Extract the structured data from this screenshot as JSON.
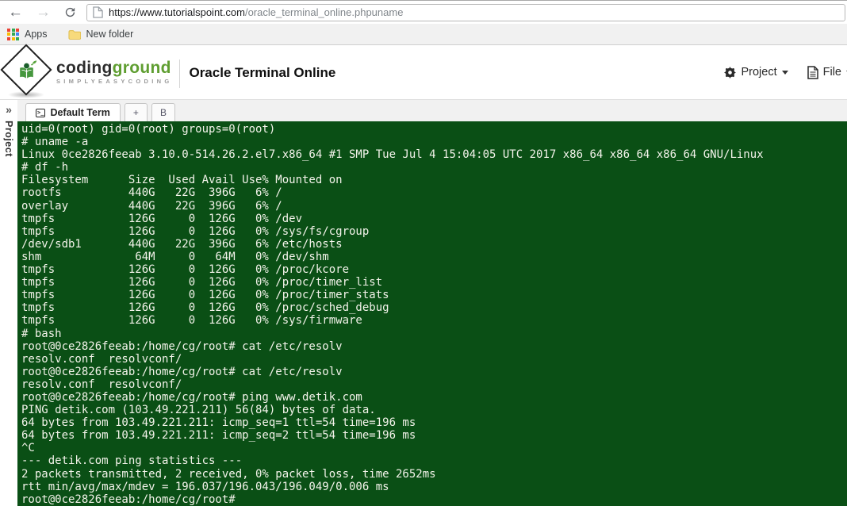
{
  "browser": {
    "back_glyph": "←",
    "forward_glyph": "→",
    "url_host": "https://www.tutorialspoint.com",
    "url_path": "/oracle_terminal_online.phpuname",
    "bookmarks": [
      {
        "label": "Apps"
      },
      {
        "label": "New folder"
      }
    ]
  },
  "header": {
    "brand_coding": "coding",
    "brand_ground": "ground",
    "brand_tagline": "SIMPLYEASYCODING",
    "page_title": "Oracle Terminal Online",
    "project_menu": "Project",
    "file_menu": "File"
  },
  "sidebar": {
    "collapse_icon": "»",
    "panel_label": "Project"
  },
  "tabs": {
    "icon_glyph": ">_",
    "active_label": "Default Term",
    "add_label": "+",
    "b_label": "B"
  },
  "terminal": {
    "lines": [
      "uid=0(root) gid=0(root) groups=0(root)",
      "# uname -a",
      "Linux 0ce2826feeab 3.10.0-514.26.2.el7.x86_64 #1 SMP Tue Jul 4 15:04:05 UTC 2017 x86_64 x86_64 x86_64 GNU/Linux",
      "# df -h",
      "Filesystem      Size  Used Avail Use% Mounted on",
      "rootfs          440G   22G  396G   6% /",
      "overlay         440G   22G  396G   6% /",
      "tmpfs           126G     0  126G   0% /dev",
      "tmpfs           126G     0  126G   0% /sys/fs/cgroup",
      "/dev/sdb1       440G   22G  396G   6% /etc/hosts",
      "shm              64M     0   64M   0% /dev/shm",
      "tmpfs           126G     0  126G   0% /proc/kcore",
      "tmpfs           126G     0  126G   0% /proc/timer_list",
      "tmpfs           126G     0  126G   0% /proc/timer_stats",
      "tmpfs           126G     0  126G   0% /proc/sched_debug",
      "tmpfs           126G     0  126G   0% /sys/firmware",
      "# bash",
      "root@0ce2826feeab:/home/cg/root# cat /etc/resolv",
      "resolv.conf  resolvconf/",
      "root@0ce2826feeab:/home/cg/root# cat /etc/resolv",
      "resolv.conf  resolvconf/",
      "root@0ce2826feeab:/home/cg/root# ping www.detik.com",
      "PING detik.com (103.49.221.211) 56(84) bytes of data.",
      "64 bytes from 103.49.221.211: icmp_seq=1 ttl=54 time=196 ms",
      "64 bytes from 103.49.221.211: icmp_seq=2 ttl=54 time=196 ms",
      "^C",
      "--- detik.com ping statistics ---",
      "2 packets transmitted, 2 received, 0% packet loss, time 2652ms",
      "rtt min/avg/max/mdev = 196.037/196.043/196.049/0.006 ms",
      "root@0ce2826feeab:/home/cg/root#"
    ]
  },
  "colors": {
    "terminal_bg": "#0a4f15",
    "terminal_fg": "#f3f3ea",
    "brand_green": "#5f9e31"
  }
}
